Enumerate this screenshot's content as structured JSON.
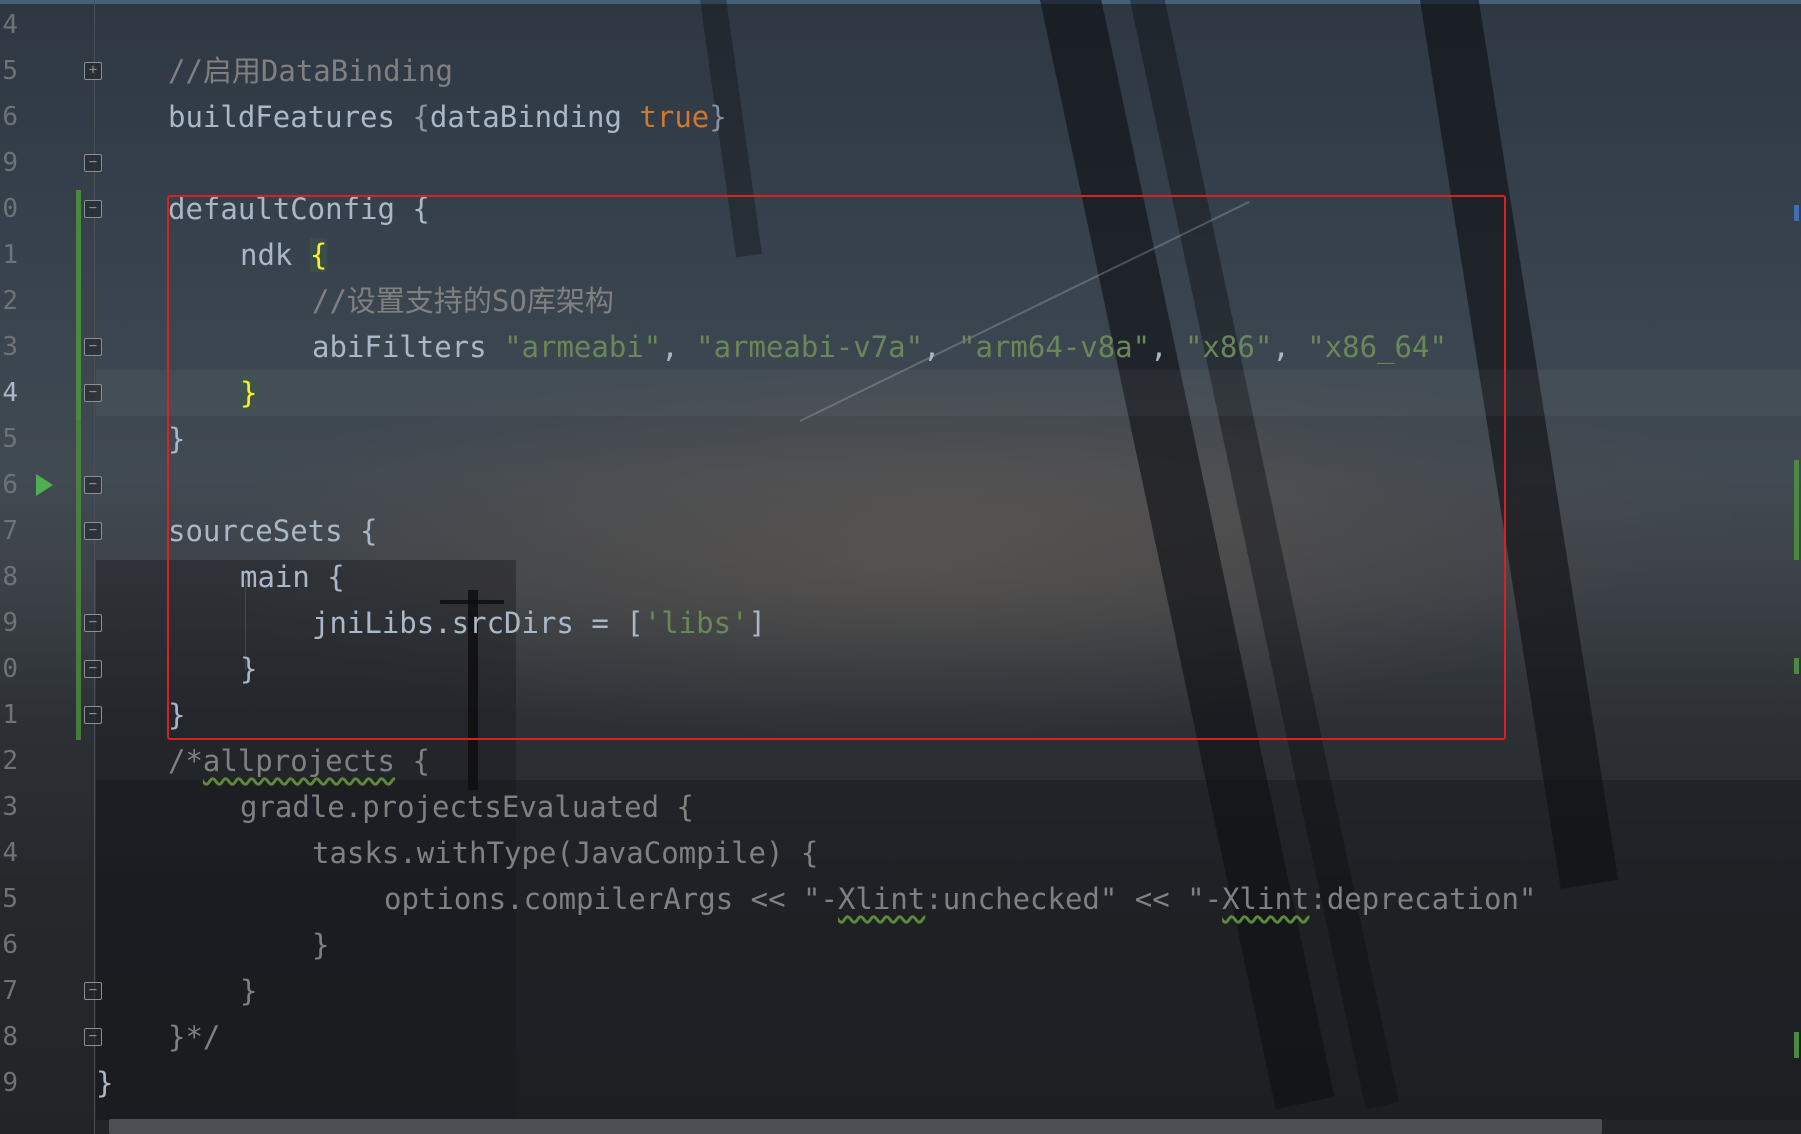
{
  "gutter": {
    "line_numbers": [
      {
        "text": "4",
        "current": false
      },
      {
        "text": "5",
        "current": false
      },
      {
        "text": "6",
        "current": false
      },
      {
        "text": "9",
        "current": false
      },
      {
        "text": "0",
        "current": false
      },
      {
        "text": "1",
        "current": false
      },
      {
        "text": "2",
        "current": false
      },
      {
        "text": "3",
        "current": false
      },
      {
        "text": "4",
        "current": true
      },
      {
        "text": "5",
        "current": false
      },
      {
        "text": "6",
        "current": false
      },
      {
        "text": "7",
        "current": false
      },
      {
        "text": "8",
        "current": false
      },
      {
        "text": "9",
        "current": false
      },
      {
        "text": "0",
        "current": false
      },
      {
        "text": "1",
        "current": false
      },
      {
        "text": "2",
        "current": false
      },
      {
        "text": "3",
        "current": false
      },
      {
        "text": "4",
        "current": false
      },
      {
        "text": "5",
        "current": false
      },
      {
        "text": "6",
        "current": false
      },
      {
        "text": "7",
        "current": false
      },
      {
        "text": "8",
        "current": false
      },
      {
        "text": "9",
        "current": false
      }
    ],
    "fold_markers": [
      {
        "row": 2,
        "symbol": "+"
      },
      {
        "row": 4,
        "symbol": "−"
      },
      {
        "row": 5,
        "symbol": "−"
      },
      {
        "row": 8,
        "symbol": "−"
      },
      {
        "row": 9,
        "symbol": "−"
      },
      {
        "row": 11,
        "symbol": "−"
      },
      {
        "row": 12,
        "symbol": "−"
      },
      {
        "row": 14,
        "symbol": "−"
      },
      {
        "row": 15,
        "symbol": "−"
      },
      {
        "row": 16,
        "symbol": "−"
      },
      {
        "row": 22,
        "symbol": "−"
      },
      {
        "row": 23,
        "symbol": "−"
      }
    ],
    "run_icon_row": 11
  },
  "code_lines": [
    {
      "indent": 0,
      "tokens": []
    },
    {
      "indent": 1,
      "tokens": [
        {
          "t": "//启用DataBinding",
          "c": "comment"
        }
      ]
    },
    {
      "indent": 1,
      "tokens": [
        {
          "t": "buildFeatures ",
          "c": "plain"
        },
        {
          "t": "{",
          "c": "brace-dim"
        },
        {
          "t": "dataBinding ",
          "c": "plain"
        },
        {
          "t": "true",
          "c": "keyword"
        },
        {
          "t": "}",
          "c": "brace-dim"
        }
      ]
    },
    {
      "indent": 0,
      "tokens": []
    },
    {
      "indent": 1,
      "tokens": [
        {
          "t": "defaultConfig {",
          "c": "plain"
        }
      ]
    },
    {
      "indent": 2,
      "tokens": [
        {
          "t": "ndk ",
          "c": "plain"
        },
        {
          "t": "{",
          "c": "brace-hl"
        }
      ]
    },
    {
      "indent": 3,
      "tokens": [
        {
          "t": "//设置支持的SO库架构",
          "c": "comment"
        }
      ]
    },
    {
      "indent": 3,
      "tokens": [
        {
          "t": "abiFilters ",
          "c": "plain"
        },
        {
          "t": "\"armeabi\"",
          "c": "string"
        },
        {
          "t": ", ",
          "c": "plain"
        },
        {
          "t": "\"armeabi-v7a\"",
          "c": "string"
        },
        {
          "t": ", ",
          "c": "plain"
        },
        {
          "t": "\"arm64-v8a\"",
          "c": "string"
        },
        {
          "t": ", ",
          "c": "plain"
        },
        {
          "t": "\"x86\"",
          "c": "string"
        },
        {
          "t": ", ",
          "c": "plain"
        },
        {
          "t": "\"x86_64\"",
          "c": "string"
        }
      ]
    },
    {
      "indent": 2,
      "tokens": [
        {
          "t": "}",
          "c": "brace-hl"
        }
      ]
    },
    {
      "indent": 1,
      "tokens": [
        {
          "t": "}",
          "c": "plain"
        }
      ]
    },
    {
      "indent": 0,
      "tokens": []
    },
    {
      "indent": 1,
      "tokens": [
        {
          "t": "sourceSets {",
          "c": "plain"
        }
      ]
    },
    {
      "indent": 2,
      "tokens": [
        {
          "t": "main {",
          "c": "plain"
        }
      ]
    },
    {
      "indent": 3,
      "tokens": [
        {
          "t": "jniLibs.srcDirs = [",
          "c": "plain"
        },
        {
          "t": "'libs'",
          "c": "string"
        },
        {
          "t": "]",
          "c": "plain"
        }
      ]
    },
    {
      "indent": 2,
      "tokens": [
        {
          "t": "}",
          "c": "plain"
        }
      ]
    },
    {
      "indent": 1,
      "tokens": [
        {
          "t": "}",
          "c": "plain"
        }
      ]
    },
    {
      "indent": 1,
      "tokens": [
        {
          "t": "/*",
          "c": "comment"
        },
        {
          "t": "allprojects",
          "c": "comment-warn"
        },
        {
          "t": " {",
          "c": "comment"
        }
      ]
    },
    {
      "indent": 2,
      "tokens": [
        {
          "t": "gradle.projectsEvaluated {",
          "c": "comment"
        }
      ]
    },
    {
      "indent": 3,
      "tokens": [
        {
          "t": "tasks.withType(JavaCompile) {",
          "c": "comment"
        }
      ]
    },
    {
      "indent": 4,
      "tokens": [
        {
          "t": "options.compilerArgs << \"-",
          "c": "comment"
        },
        {
          "t": "Xlint",
          "c": "comment-warn"
        },
        {
          "t": ":unchecked\" << \"-",
          "c": "comment"
        },
        {
          "t": "Xlint",
          "c": "comment-warn"
        },
        {
          "t": ":deprecation\"",
          "c": "comment"
        }
      ]
    },
    {
      "indent": 3,
      "tokens": [
        {
          "t": "}",
          "c": "comment"
        }
      ]
    },
    {
      "indent": 2,
      "tokens": [
        {
          "t": "}",
          "c": "comment"
        }
      ]
    },
    {
      "indent": 1,
      "tokens": [
        {
          "t": "}*/",
          "c": "comment"
        }
      ]
    },
    {
      "indent": 0,
      "tokens": [
        {
          "t": "}",
          "c": "plain"
        }
      ]
    }
  ],
  "colors": {
    "highlight_box": "#d9211f",
    "keyword": "#cc7832",
    "string": "#6a8759",
    "comment": "#808080",
    "brace_match": "#ffef28",
    "plain": "#a9b7c6"
  }
}
